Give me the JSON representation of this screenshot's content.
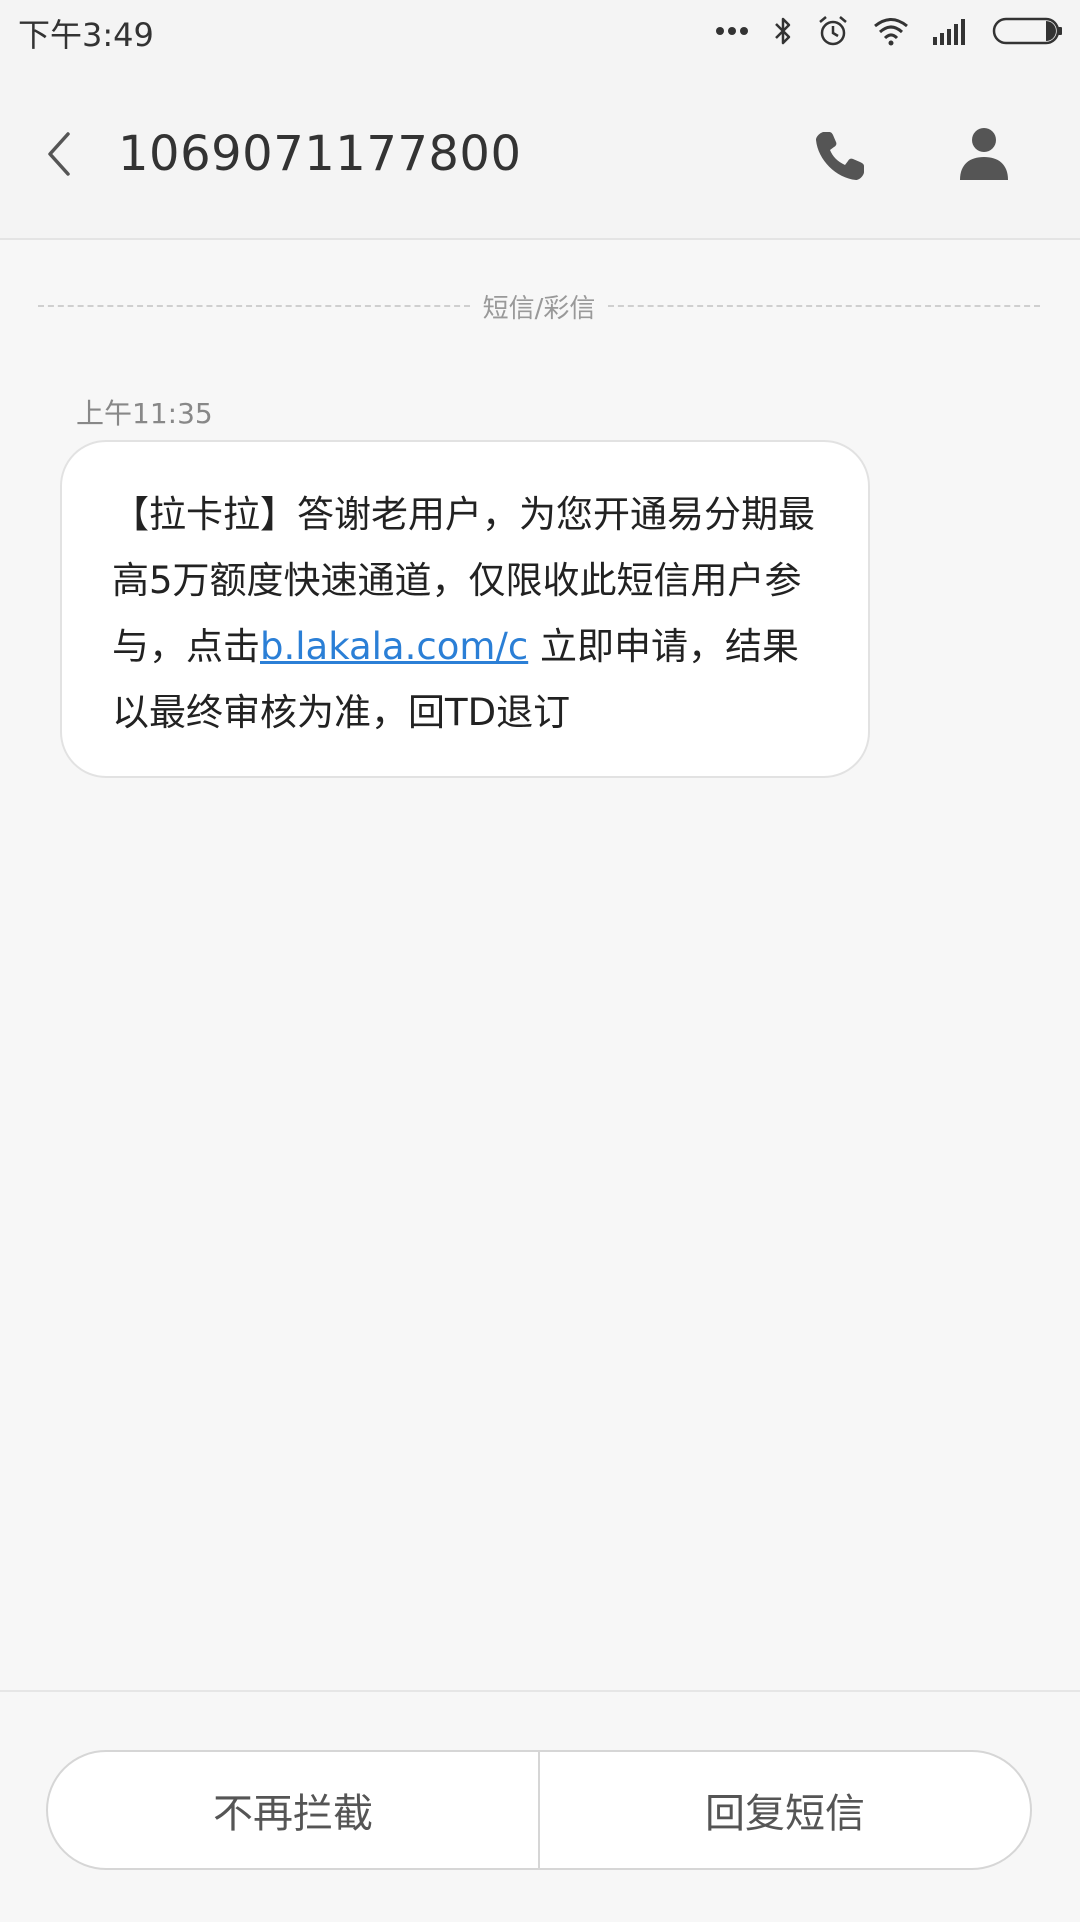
{
  "status_bar": {
    "time": "下午3:49",
    "icons": [
      "more-dots-icon",
      "bluetooth-icon",
      "alarm-icon",
      "wifi-icon",
      "signal-icon",
      "battery-icon"
    ]
  },
  "header": {
    "title": "1069071177800",
    "back_icon": "chevron-left-icon",
    "call_icon": "phone-icon",
    "contact_icon": "person-icon"
  },
  "conversation": {
    "divider_label": "短信/彩信",
    "messages": [
      {
        "time": "上午11:35",
        "text_before_link": "【拉卡拉】答谢老用户，为您开通易分期最高5万额度快速通道，仅限收此短信用户参与，点击",
        "link": "b.lakala.com/c",
        "text_after_link": " 立即申请，结果以最终审核为准，回TD退订"
      }
    ]
  },
  "bottom_actions": {
    "block_label": "不再拦截",
    "reply_label": "回复短信"
  },
  "colors": {
    "background": "#f7f7f7",
    "bubble": "#ffffff",
    "link": "#2b7fd6",
    "header": "#f4f4f4"
  }
}
